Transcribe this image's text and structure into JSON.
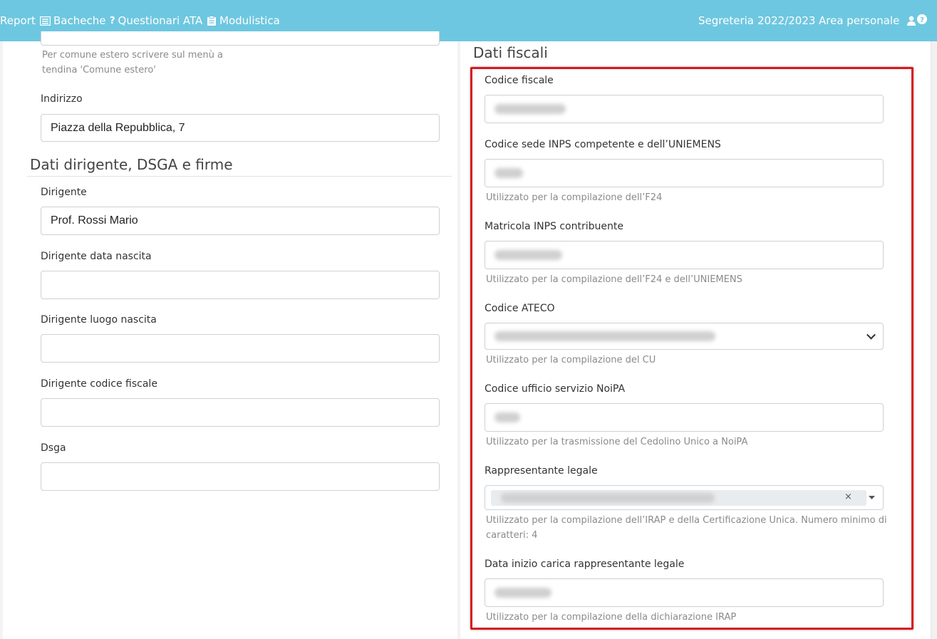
{
  "navbar": {
    "items": [
      {
        "label": "Report"
      },
      {
        "label": "Bacheche"
      },
      {
        "label": "Questionari ATA"
      },
      {
        "label": "Modulistica"
      }
    ],
    "right": {
      "segreteria": "Segreteria",
      "year": "2022/2023",
      "area_personale": "Area personale"
    }
  },
  "left": {
    "comune_help": "Per comune estero scrivere sul menù a",
    "comune_help_2": "tendina 'Comune estero'",
    "indirizzo": {
      "label": "Indirizzo",
      "value": "Piazza della Repubblica, 7"
    },
    "section_title": "Dati dirigente, DSGA e firme",
    "dirigente": {
      "label": "Dirigente",
      "value": "Prof. Rossi Mario"
    },
    "dirigente_data_nascita": {
      "label": "Dirigente data nascita",
      "value": ""
    },
    "dirigente_luogo_nascita": {
      "label": "Dirigente luogo nascita",
      "value": ""
    },
    "dirigente_codice_fiscale": {
      "label": "Dirigente codice fiscale",
      "value": ""
    },
    "dsga": {
      "label": "Dsga",
      "value": ""
    }
  },
  "right": {
    "section_title": "Dati fiscali",
    "codice_fiscale": {
      "label": "Codice fiscale"
    },
    "codice_sede_inps": {
      "label": "Codice sede INPS competente e dell’UNIEMENS",
      "help": "Utilizzato per la compilazione dell’F24"
    },
    "matricola_inps": {
      "label": "Matricola INPS contribuente",
      "help": "Utilizzato per la compilazione dell’F24 e dell’UNIEMENS"
    },
    "codice_ateco": {
      "label": "Codice ATECO",
      "help": "Utilizzato per la compilazione del CU"
    },
    "codice_ufficio_noipa": {
      "label": "Codice ufficio servizio NoiPA",
      "help": "Utilizzato per la trasmissione del Cedolino Unico a NoiPA"
    },
    "rappresentante_legale": {
      "label": "Rappresentante legale",
      "help": "Utilizzato per la compilazione dell’IRAP e della Certificazione Unica. Numero minimo di",
      "help_2": "caratteri: 4",
      "clear": "×"
    },
    "data_inizio_carica": {
      "label": "Data inizio carica rappresentante legale",
      "help": "Utilizzato per la compilazione della dichiarazione IRAP"
    }
  },
  "colors": {
    "navbar": "#6ec7e0",
    "highlight": "#d9161e"
  }
}
